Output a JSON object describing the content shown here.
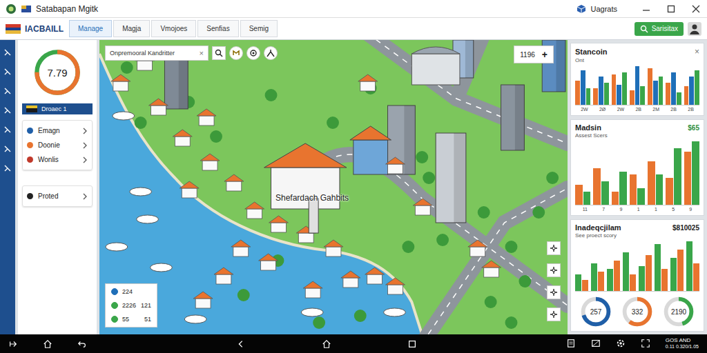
{
  "window": {
    "title": "Satabapan Mgitk",
    "account": "Uagrats"
  },
  "menu": {
    "brand": "IACBAILL",
    "tabs": [
      {
        "label": "Manage",
        "selected": true
      },
      {
        "label": "Magja",
        "selected": false
      },
      {
        "label": "Vmojoes",
        "selected": false
      },
      {
        "label": "Senfias",
        "selected": false
      },
      {
        "label": "Semig",
        "selected": false
      }
    ],
    "action": "Sarisitax"
  },
  "sidebar": {
    "gauge": {
      "value": "7.79",
      "level": 0.75
    },
    "badge": "Droaec 1",
    "items": [
      {
        "label": "Emagn",
        "color": "#1f5fa8"
      },
      {
        "label": "Doonie",
        "color": "#e8742f"
      },
      {
        "label": "Wonlis",
        "color": "#c0392b"
      }
    ],
    "extra": {
      "label": "Proted",
      "color": "#222222"
    }
  },
  "map": {
    "search": {
      "placeholder": "Onpremooral Kandritter",
      "clear": "×"
    },
    "counter": "1196",
    "counter_action": "+",
    "label": "Shefardach Gahbits",
    "legend": [
      {
        "value": "224",
        "extra": "",
        "color": "#1f6fb8"
      },
      {
        "value": "2226",
        "extra": "121",
        "color": "#3aa64a"
      },
      {
        "value": "55",
        "extra": "51",
        "color": "#3aa64a"
      }
    ]
  },
  "charts": [
    {
      "title": "Stancoin",
      "subtitle": "Ont",
      "value": "",
      "close": "×",
      "ticks": [
        "2W",
        "2Ø",
        "2W",
        "2B",
        "2M",
        "2B",
        "2B"
      ],
      "series": [
        {
          "color": "#e8742f",
          "values": [
            60,
            40,
            75,
            35,
            90,
            55,
            45
          ]
        },
        {
          "color": "#1f6fb8",
          "values": [
            85,
            70,
            50,
            95,
            60,
            80,
            70
          ]
        },
        {
          "color": "#3aa64a",
          "values": [
            40,
            55,
            80,
            45,
            70,
            30,
            85
          ]
        }
      ]
    },
    {
      "title": "Madsin",
      "subtitle": "Assest Scers",
      "value": "$65",
      "close": "",
      "ticks": [
        "11",
        "7",
        "9",
        "1",
        "1",
        "5",
        "9"
      ],
      "series": [
        {
          "color": "#e8742f",
          "values": [
            30,
            55,
            20,
            45,
            65,
            40,
            80
          ]
        },
        {
          "color": "#3aa64a",
          "values": [
            20,
            35,
            50,
            25,
            45,
            85,
            95
          ]
        }
      ]
    },
    {
      "title": "Inadeqcjilam",
      "subtitle": "See proect scory",
      "value": "$810025",
      "close": "",
      "ticks": [],
      "series": [
        {
          "color": "#3aa64a",
          "values": [
            30,
            50,
            40,
            70,
            45,
            85,
            60,
            90
          ]
        },
        {
          "color": "#e8742f",
          "values": [
            20,
            35,
            55,
            30,
            65,
            40,
            75,
            50
          ]
        }
      ]
    }
  ],
  "donuts": [
    {
      "value": "257",
      "level": 0.7,
      "color": "#1f5fa8"
    },
    {
      "value": "332",
      "level": 0.6,
      "color": "#e8742f"
    },
    {
      "value": "2190",
      "level": 0.45,
      "color": "#3aa64a"
    }
  ],
  "status": {
    "line1": "GOS AND",
    "line2": "0.11 0.320/1.05"
  }
}
